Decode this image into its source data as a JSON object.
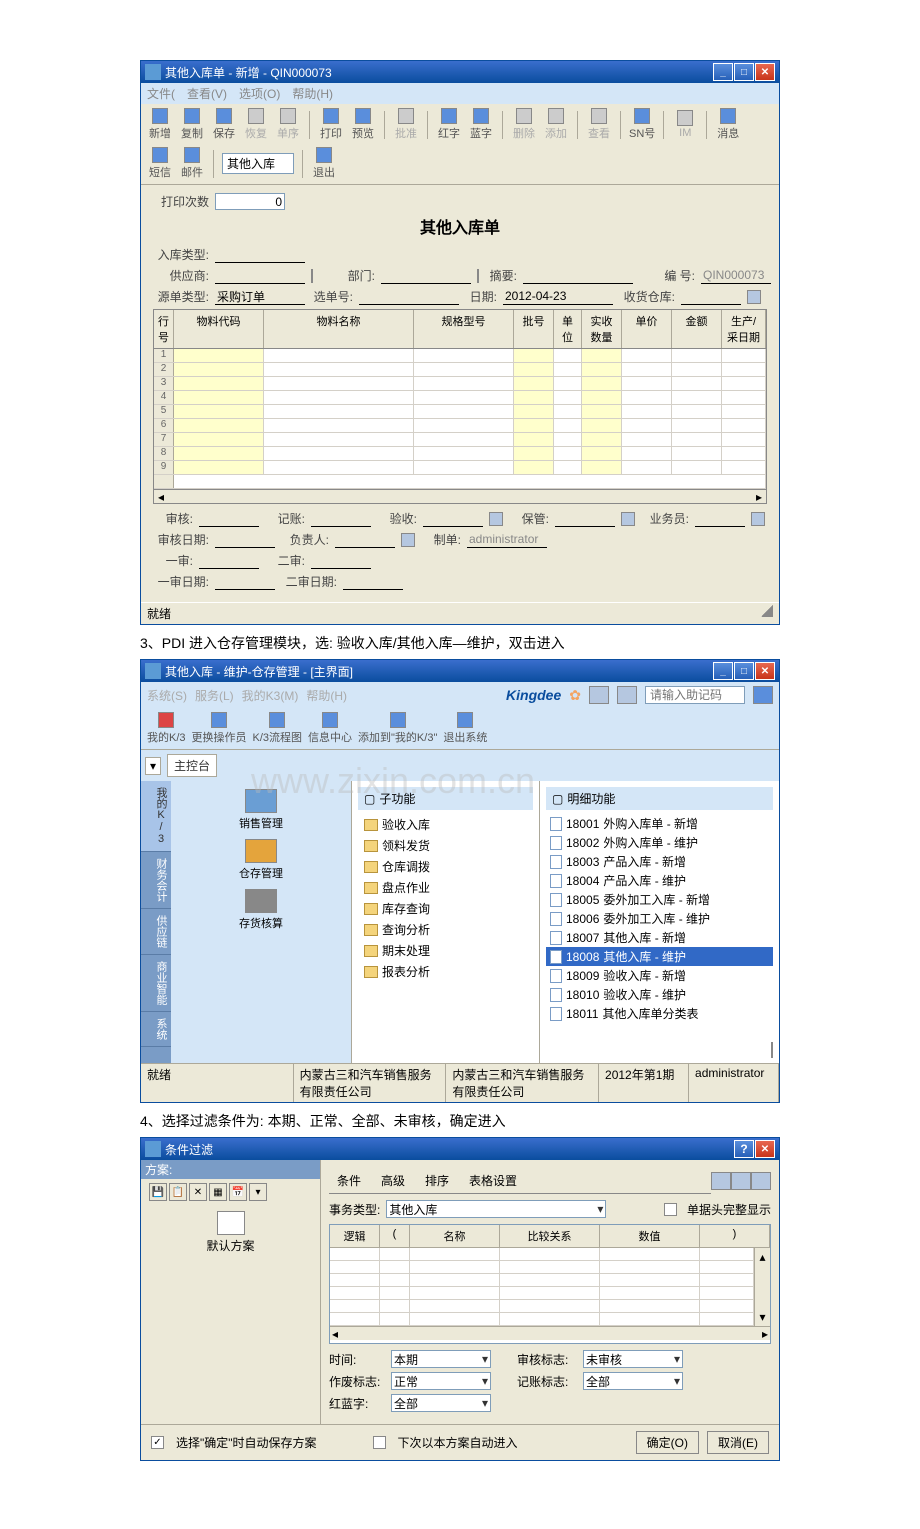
{
  "win1": {
    "title": "其他入库单  -  新增  -  QIN000073",
    "menu": {
      "file": "文件(",
      "view": "查看(V)",
      "option": "选项(O)",
      "help": "帮助(H)"
    },
    "toolbar": {
      "new": "新增",
      "copy": "复制",
      "save": "保存",
      "undo": "恢复",
      "seq": "单序",
      "print": "打印",
      "preview": "预览",
      "batch": "批准",
      "red": "红字",
      "blue": "蓝字",
      "del": "删除",
      "add": "添加",
      "view": "查看",
      "sn": "SN号",
      "im": "IM",
      "msg": "消息",
      "sms": "短信",
      "mail": "邮件",
      "right": "其他入库",
      "exit": "退出"
    },
    "form": {
      "printcount_label": "打印次数",
      "printcount": "0",
      "title": "其他入库单",
      "type_label": "入库类型:",
      "supplier_label": "供应商:",
      "dept_label": "部门:",
      "summary_label": "摘要:",
      "no_label": "编    号:",
      "no": "QIN000073",
      "srctype_label": "源单类型:",
      "srctype": "采购订单",
      "orderno_label": "选单号:",
      "date_label": "日期:",
      "date": "2012-04-23",
      "warehouse_label": "收货仓库:"
    },
    "grid": {
      "cols": {
        "row": "行号",
        "code": "物料代码",
        "name": "物料名称",
        "spec": "规格型号",
        "batch": "批号",
        "unit": "单位",
        "qty": "实收数量",
        "price": "单价",
        "amount": "金额",
        "pdate": "生产/采日期"
      }
    },
    "form2": {
      "review_label": "审核:",
      "book_label": "记账:",
      "accept_label": "验收:",
      "keeper_label": "保管:",
      "staff_label": "业务员:",
      "review_date_label": "审核日期:",
      "owner_label": "负责人:",
      "maker_label": "制单:",
      "maker": "administrator",
      "r1": "一审:",
      "r2": "二审:",
      "r1d": "一审日期:",
      "r2d": "二审日期:"
    },
    "status": "就绪"
  },
  "step3": "3、PDI 进入仓存管理模块，选: 验收入库/其他入库—维护，双击进入",
  "win2": {
    "title": "其他入库  -  维护-仓存管理  -  [主界面]",
    "menu": {
      "sys": "系统(S)",
      "svc": "服务(L)",
      "myk3": "我的K3(M)",
      "help": "帮助(H)"
    },
    "brand": "Kingdee",
    "search_ph": "请输入助记码",
    "toolbar": {
      "myk3": "我的K/3",
      "switch": "更换操作员",
      "flow": "K/3流程图",
      "info": "信息中心",
      "addto": "添加到\"我的K/3\"",
      "exit": "退出系统"
    },
    "console": "主控台",
    "watermark": "www.zixin.com.cn",
    "tabs": {
      "myk3": "我的K/3",
      "fin": "财务会计",
      "supply": "供应链",
      "biz": "商业智能",
      "sys": "系统"
    },
    "nav": {
      "sales": "销售管理",
      "warehouse": "仓存管理",
      "stock": "存货核算"
    },
    "func": {
      "head": "子功能",
      "items": [
        "验收入库",
        "领料发货",
        "仓库调拨",
        "盘点作业",
        "库存查询",
        "查询分析",
        "期末处理",
        "报表分析"
      ]
    },
    "detail": {
      "head": "明细功能",
      "items": [
        {
          "code": "18001",
          "name": "外购入库单 - 新增"
        },
        {
          "code": "18002",
          "name": "外购入库单 - 维护"
        },
        {
          "code": "18003",
          "name": "产品入库 - 新增"
        },
        {
          "code": "18004",
          "name": "产品入库 - 维护"
        },
        {
          "code": "18005",
          "name": "委外加工入库 - 新增"
        },
        {
          "code": "18006",
          "name": "委外加工入库 - 维护"
        },
        {
          "code": "18007",
          "name": "其他入库 - 新增"
        },
        {
          "code": "18008",
          "name": "其他入库 - 维护"
        },
        {
          "code": "18009",
          "name": "验收入库 - 新增"
        },
        {
          "code": "18010",
          "name": "验收入库 - 维护"
        },
        {
          "code": "18011",
          "name": "其他入库单分类表"
        }
      ]
    },
    "status": {
      "ready": "就绪",
      "company1": "内蒙古三和汽车销售服务有限责任公司",
      "company2": "内蒙古三和汽车销售服务有限责任公司",
      "period": "2012年第1期",
      "user": "administrator"
    }
  },
  "step4": "4、选择过滤条件为: 本期、正常、全部、未审核，确定进入",
  "win3": {
    "title": "条件过滤",
    "scheme_label": "方案:",
    "default_scheme": "默认方案",
    "tabs": {
      "cond": "条件",
      "adv": "高级",
      "sort": "排序",
      "tbl": "表格设置"
    },
    "biztype_label": "事务类型:",
    "biztype": "其他入库",
    "headcomplete": "单据头完整显示",
    "grid": {
      "logic": "逻辑",
      "lp": "(",
      "name": "名称",
      "rel": "比较关系",
      "val": "数值",
      "rp": ")"
    },
    "fields": {
      "time_label": "时间:",
      "time": "本期",
      "audit_label": "审核标志:",
      "audit": "未审核",
      "void_label": "作废标志:",
      "void": "正常",
      "book_label": "记账标志:",
      "book": "全部",
      "rb_label": "红蓝字:",
      "rb": "全部"
    },
    "autosave": "选择\"确定\"时自动保存方案",
    "autonext": "下次以本方案自动进入",
    "ok": "确定(O)",
    "cancel": "取消(E)"
  }
}
